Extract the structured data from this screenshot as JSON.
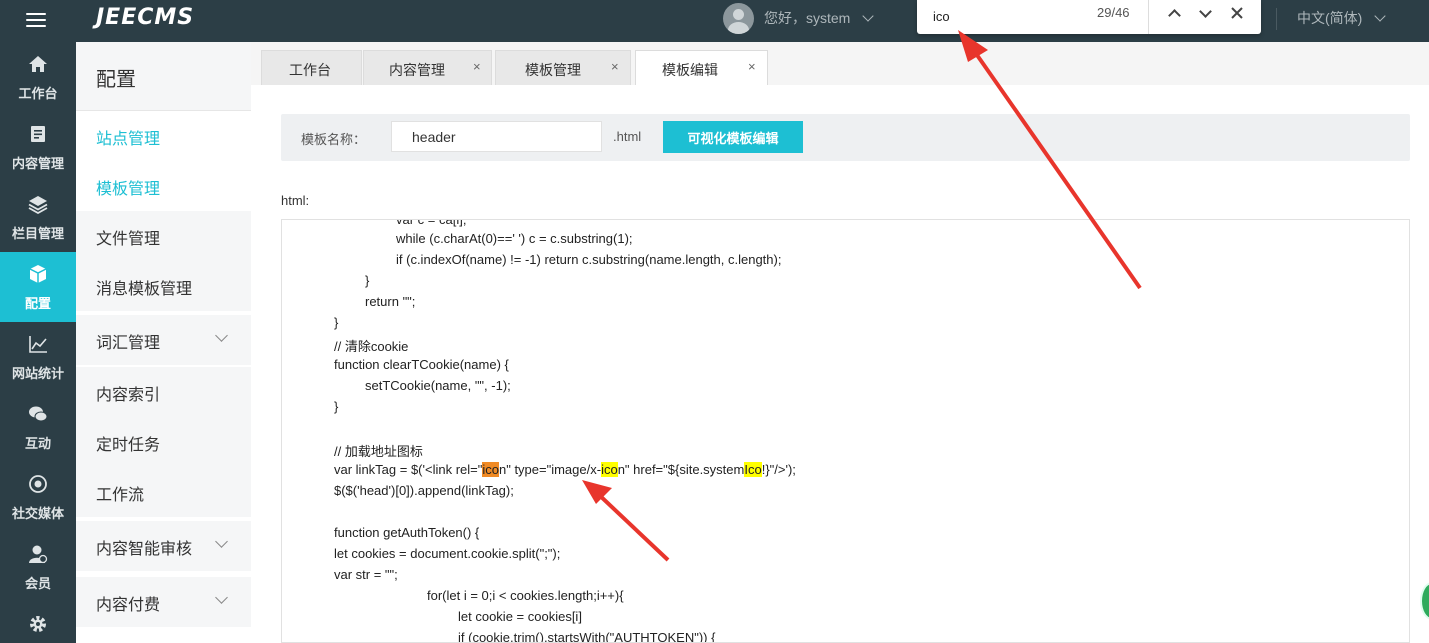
{
  "app": {
    "logo": "JEECMS",
    "greeting": "您好，system",
    "language": "中文(简体)"
  },
  "find": {
    "query": "ico",
    "count": "29/46"
  },
  "rail": [
    {
      "label": "工作台",
      "icon": "home-icon"
    },
    {
      "label": "内容管理",
      "icon": "document-edit-icon"
    },
    {
      "label": "栏目管理",
      "icon": "layers-icon"
    },
    {
      "label": "配置",
      "icon": "cube-icon",
      "active": true
    },
    {
      "label": "网站统计",
      "icon": "line-chart-icon"
    },
    {
      "label": "互动",
      "icon": "chat-bubbles-icon"
    },
    {
      "label": "社交媒体",
      "icon": "target-icon"
    },
    {
      "label": "会员",
      "icon": "member-icon"
    },
    {
      "label": "",
      "icon": "gear-icon"
    }
  ],
  "submenu": {
    "title": "配置",
    "items": [
      {
        "label": "站点管理",
        "highlight": true
      },
      {
        "label": "模板管理",
        "highlight": true
      },
      {
        "label": "文件管理"
      },
      {
        "label": "消息模板管理"
      },
      {
        "label": "词汇管理",
        "expandable": true
      },
      {
        "label": "内容索引"
      },
      {
        "label": "定时任务"
      },
      {
        "label": "工作流"
      },
      {
        "label": "内容智能审核",
        "expandable": true
      },
      {
        "label": "内容付费",
        "expandable": true
      }
    ]
  },
  "tabs": [
    {
      "label": "工作台",
      "closable": false
    },
    {
      "label": "内容管理",
      "closable": true
    },
    {
      "label": "模板管理",
      "closable": true
    },
    {
      "label": "模板编辑",
      "closable": true,
      "active": true
    }
  ],
  "tab_close_glyph": "×",
  "form": {
    "name_label": "模板名称：",
    "name_value": "header",
    "extension": ".html",
    "visual_button": "可视化模板编辑",
    "html_label": "html:"
  },
  "code": {
    "l0": "var c = ca[i];",
    "l1": "while (c.charAt(0)==' ') c = c.substring(1);",
    "l2": "if (c.indexOf(name) != -1) return c.substring(name.length, c.length);",
    "l3": "}",
    "l4": "return \"\";",
    "l5": "}",
    "l6": "// 清除cookie",
    "l7": "function clearTCookie(name) {",
    "l8": "setTCookie(name, \"\", -1);",
    "l9": "}",
    "l10a": "var linkTag = $('<link rel=\"",
    "l10m1": "ico",
    "l10b": "n\" type=\"image/x-",
    "l10m2": "ico",
    "l10c": "n\" href=\"${site.system",
    "l10m3": "Ico",
    "l10d": "!}\"/>');",
    "l10pre": "// 加载地址图标",
    "l11": "$($('head')[0]).append(linkTag);",
    "l12": "function getAuthToken() {",
    "l13": "let cookies = document.cookie.split(\";\");",
    "l14": "var str = \"\";",
    "l15": "for(let i = 0;i < cookies.length;i++){",
    "l16": "let cookie = cookies[i]",
    "l17": "if (cookie.trim().startsWith(\"AUTHTOKEN\")) {"
  },
  "colors": {
    "accent": "#1dbfd3",
    "sidebar": "#2c3e46",
    "match": "#ffff00",
    "current_match": "#f08a24",
    "annotation_arrow": "#e8352c"
  }
}
